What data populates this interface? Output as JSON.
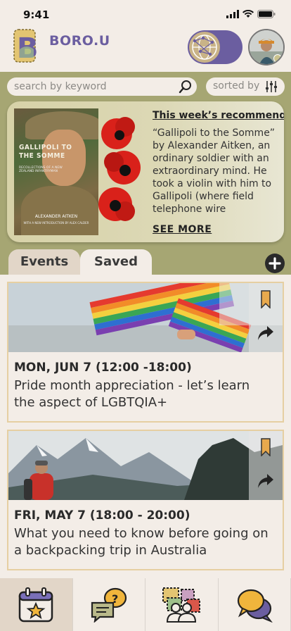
{
  "status": {
    "time": "9:41"
  },
  "header": {
    "brand": "BORO.U",
    "logo_letter": "B"
  },
  "search": {
    "placeholder": "search by keyword"
  },
  "sort": {
    "label": "sorted by"
  },
  "recommend": {
    "title": "This week’s recommend:",
    "text": "“Gallipoli to the Somme” by Alexander Aitken, an ordinary soldier with an extraordinary mind. He took a violin with him to Gallipoli (where field telephone wire",
    "more": "SEE MORE",
    "book": {
      "title": "GALLIPOLI TO THE SOMME",
      "subtitle": "RECOLLECTIONS OF A NEW ZEALAND INFANTRYMAN",
      "author": "ALEXANDER AITKEN",
      "intro": "WITH A NEW INTRODUCTION BY ALEX CALDER"
    }
  },
  "tabs": [
    {
      "label": "Events"
    },
    {
      "label": "Saved"
    }
  ],
  "events": [
    {
      "date": "MON, JUN 7 (12:00 -18:00)",
      "desc": "Pride month appreciation - let’s learn the aspect of LGBTQIA+"
    },
    {
      "date": "FRI, MAY 7 (18:00 - 20:00)",
      "desc": "What you need to know before going on a backpacking trip in Australia"
    }
  ],
  "colors": {
    "accent": "#6b5ea0",
    "olive": "#a6a673",
    "cream": "#f3ede7",
    "card_border": "#e6cfa2",
    "bookmark": "#e8a94d"
  },
  "icons": [
    "signal-icon",
    "wifi-icon",
    "battery-icon",
    "search-icon",
    "filter-icon",
    "bookmark-icon",
    "share-icon",
    "plus-icon",
    "calendar-star-icon",
    "question-chat-icon",
    "community-icon",
    "chat-bubbles-icon"
  ]
}
